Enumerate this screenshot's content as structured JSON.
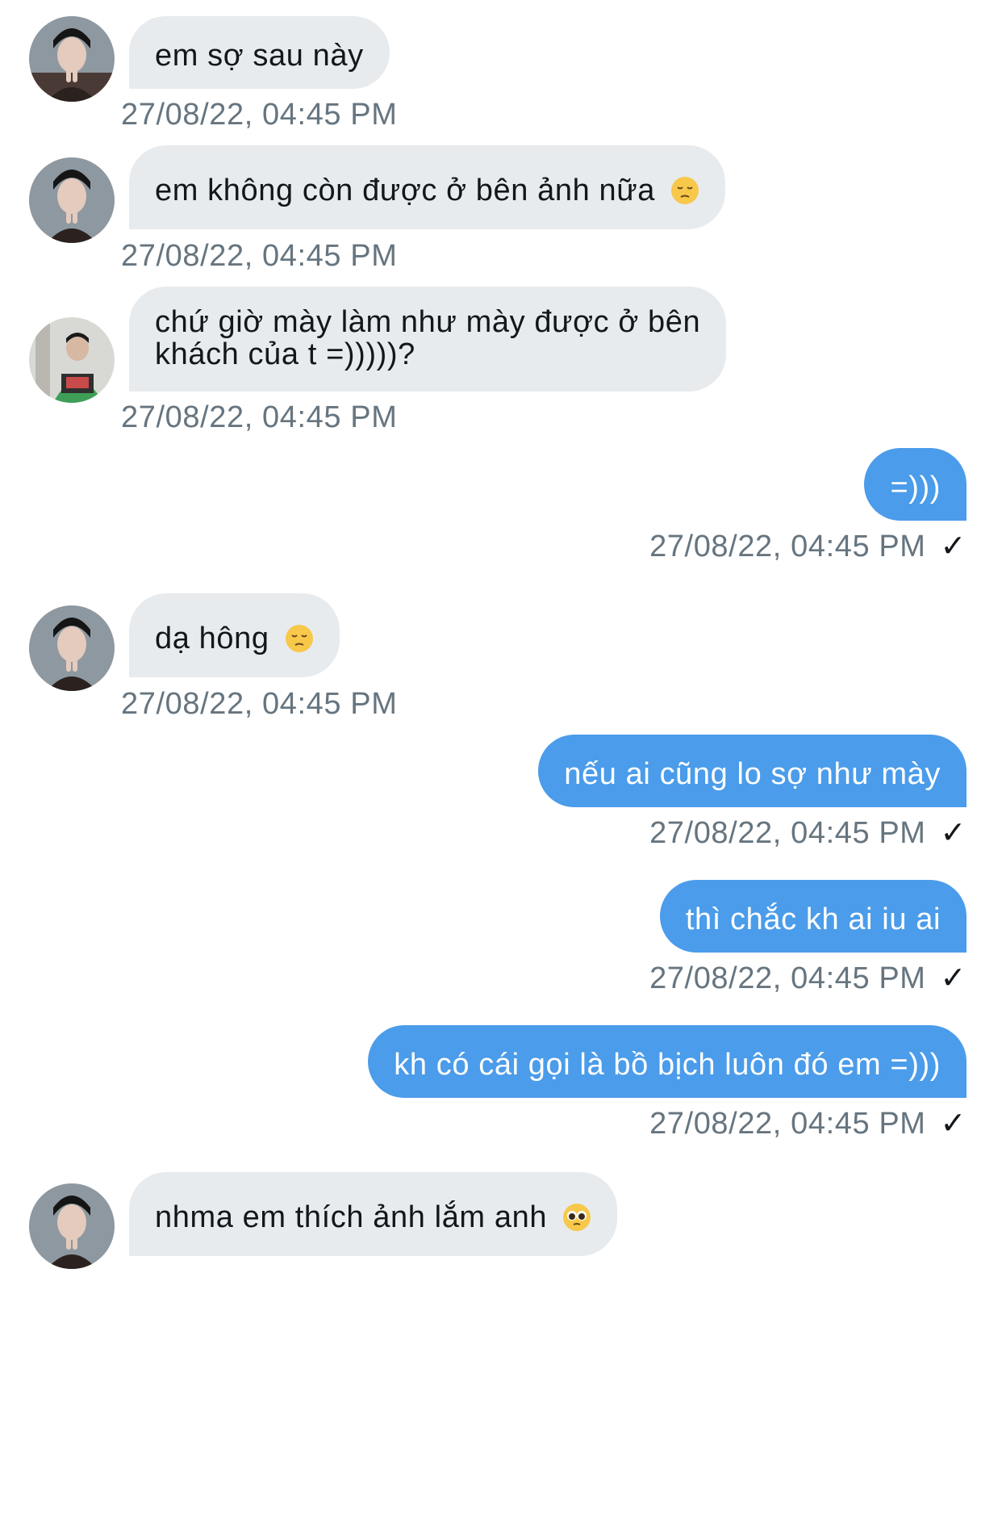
{
  "messages": [
    {
      "side": "in",
      "avatar": "man-peace-sign-avatar",
      "text": "em sợ sau này",
      "time": "27/08/22, 04:45 PM"
    },
    {
      "side": "in",
      "avatar": "man-peace-sign-avatar",
      "text": "em không còn được ở bên ảnh nữa",
      "emoji": "pensive-face",
      "time": "27/08/22, 04:45 PM"
    },
    {
      "side": "in",
      "avatar": "green-hoodie-avatar",
      "lines": [
        "chứ giờ mày làm như mày được ở bên",
        "khách của t =)))))?"
      ],
      "time": "27/08/22, 04:45 PM"
    },
    {
      "side": "out",
      "text": "=)))",
      "time": "27/08/22, 04:45 PM",
      "status": "✓"
    },
    {
      "side": "in",
      "avatar": "man-peace-sign-avatar",
      "text": "dạ hông",
      "emoji": "pensive-face",
      "time": "27/08/22, 04:45 PM"
    },
    {
      "side": "out",
      "text": "nếu ai cũng lo sợ như mày",
      "time": "27/08/22, 04:45 PM",
      "status": "✓"
    },
    {
      "side": "out",
      "text": "thì chắc kh ai iu ai",
      "time": "27/08/22, 04:45 PM",
      "status": "✓"
    },
    {
      "side": "out",
      "text": "kh có cái gọi là bồ bịch luôn đó em =)))",
      "time": "27/08/22, 04:45 PM",
      "status": "✓"
    },
    {
      "side": "in",
      "avatar": "man-peace-sign-avatar",
      "text": "nhma em thích ảnh lắm anh",
      "emoji": "pleading-face"
    }
  ],
  "colors": {
    "incoming_bubble": "#e8ebee",
    "outgoing_bubble": "#4b9cea",
    "timestamp": "#66757f",
    "text": "#14171a"
  }
}
